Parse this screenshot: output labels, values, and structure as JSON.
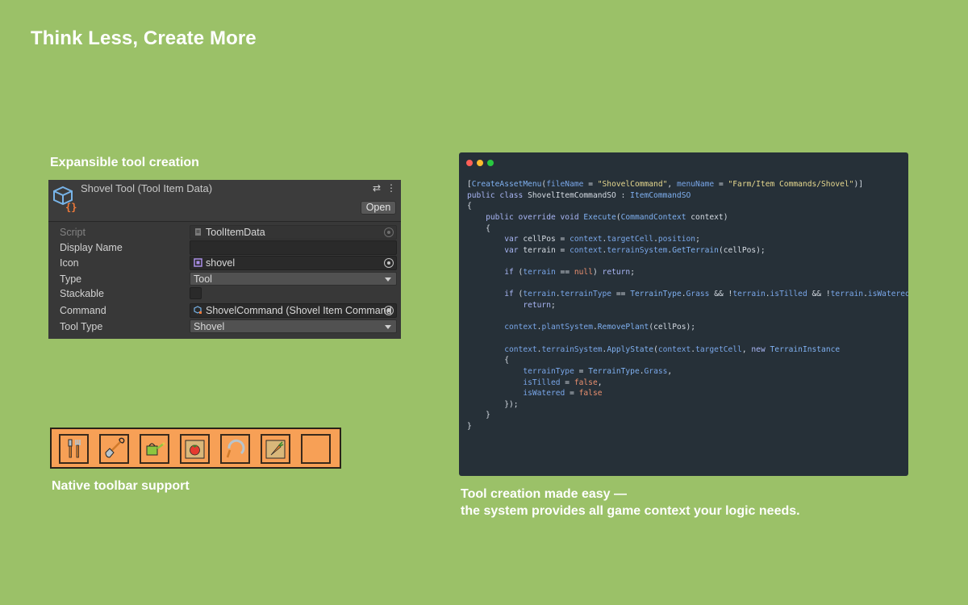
{
  "headline": "Think Less, Create More",
  "sections": {
    "expansible_label": "Expansible tool creation",
    "native_label": "Native toolbar support",
    "caption_line1": "Tool creation made easy —",
    "caption_line2": "the system provides all game context your logic needs."
  },
  "inspector": {
    "title": "Shovel Tool (Tool Item Data)",
    "open_button": "Open",
    "header_icons": [
      "settings-sliders-icon",
      "more-vert-icon"
    ],
    "rows": {
      "script": {
        "label": "Script",
        "value": "ToolItemData"
      },
      "display_name": {
        "label": "Display Name",
        "value": ""
      },
      "icon": {
        "label": "Icon",
        "value": "shovel"
      },
      "type": {
        "label": "Type",
        "value": "Tool"
      },
      "stackable": {
        "label": "Stackable",
        "checked": false
      },
      "command": {
        "label": "Command",
        "value": "ShovelCommand (Shovel Item Command"
      },
      "tool_type": {
        "label": "Tool Type",
        "value": "Shovel"
      }
    }
  },
  "toolbar": {
    "slots": [
      "garden-tools-icon",
      "shovel-icon",
      "watering-can-icon",
      "tomato-seed-bag-icon",
      "sickle-icon",
      "carrot-seed-bag-icon",
      "empty-slot"
    ]
  },
  "code_window": {
    "dot_colors": [
      "#ff5f57",
      "#febc2e",
      "#28c840"
    ],
    "colors": {
      "plain": "#d5dbe3",
      "keyword": "#a9b6f5",
      "type": "#7fb0f0",
      "string": "#e6d88f",
      "member": "#79a6e8",
      "literal": "#e98f6f"
    },
    "lines": [
      [
        [
          "[",
          "plain"
        ],
        [
          "CreateAssetMenu",
          "type"
        ],
        [
          "(",
          "plain"
        ],
        [
          "fileName",
          "member"
        ],
        [
          " = ",
          "plain"
        ],
        [
          "\"ShovelCommand\"",
          "string"
        ],
        [
          ", ",
          "plain"
        ],
        [
          "menuName",
          "member"
        ],
        [
          " = ",
          "plain"
        ],
        [
          "\"Farm/Item Commands/Shovel\"",
          "string"
        ],
        [
          ")]",
          "plain"
        ]
      ],
      [
        [
          "public class ",
          "keyword"
        ],
        [
          "ShovelItemCommandSO",
          "plain"
        ],
        [
          " : ",
          "plain"
        ],
        [
          "ItemCommandSO",
          "type"
        ]
      ],
      [
        [
          "{",
          "plain"
        ]
      ],
      [
        [
          "    ",
          "plain"
        ],
        [
          "public override void ",
          "keyword"
        ],
        [
          "Execute",
          "type"
        ],
        [
          "(",
          "plain"
        ],
        [
          "CommandContext",
          "type"
        ],
        [
          " context)",
          "plain"
        ]
      ],
      [
        [
          "    {",
          "plain"
        ]
      ],
      [
        [
          "        ",
          "plain"
        ],
        [
          "var ",
          "keyword"
        ],
        [
          "cellPos = ",
          "plain"
        ],
        [
          "context",
          "member"
        ],
        [
          ".",
          "plain"
        ],
        [
          "targetCell",
          "member"
        ],
        [
          ".",
          "plain"
        ],
        [
          "position",
          "member"
        ],
        [
          ";",
          "plain"
        ]
      ],
      [
        [
          "        ",
          "plain"
        ],
        [
          "var ",
          "keyword"
        ],
        [
          "terrain = ",
          "plain"
        ],
        [
          "context",
          "member"
        ],
        [
          ".",
          "plain"
        ],
        [
          "terrainSystem",
          "member"
        ],
        [
          ".",
          "plain"
        ],
        [
          "GetTerrain",
          "type"
        ],
        [
          "(cellPos);",
          "plain"
        ]
      ],
      [],
      [
        [
          "        ",
          "plain"
        ],
        [
          "if ",
          "keyword"
        ],
        [
          "(",
          "plain"
        ],
        [
          "terrain",
          "member"
        ],
        [
          " == ",
          "plain"
        ],
        [
          "null",
          "literal"
        ],
        [
          ") ",
          "plain"
        ],
        [
          "return",
          "keyword"
        ],
        [
          ";",
          "plain"
        ]
      ],
      [],
      [
        [
          "        ",
          "plain"
        ],
        [
          "if ",
          "keyword"
        ],
        [
          "(",
          "plain"
        ],
        [
          "terrain",
          "member"
        ],
        [
          ".",
          "plain"
        ],
        [
          "terrainType",
          "member"
        ],
        [
          " == ",
          "plain"
        ],
        [
          "TerrainType",
          "type"
        ],
        [
          ".",
          "plain"
        ],
        [
          "Grass",
          "member"
        ],
        [
          " && !",
          "plain"
        ],
        [
          "terrain",
          "member"
        ],
        [
          ".",
          "plain"
        ],
        [
          "isTilled",
          "member"
        ],
        [
          " && !",
          "plain"
        ],
        [
          "terrain",
          "member"
        ],
        [
          ".",
          "plain"
        ],
        [
          "isWatered",
          "member"
        ],
        [
          ")",
          "plain"
        ]
      ],
      [
        [
          "            ",
          "plain"
        ],
        [
          "return",
          "keyword"
        ],
        [
          ";",
          "plain"
        ]
      ],
      [],
      [
        [
          "        ",
          "plain"
        ],
        [
          "context",
          "member"
        ],
        [
          ".",
          "plain"
        ],
        [
          "plantSystem",
          "member"
        ],
        [
          ".",
          "plain"
        ],
        [
          "RemovePlant",
          "type"
        ],
        [
          "(cellPos);",
          "plain"
        ]
      ],
      [],
      [
        [
          "        ",
          "plain"
        ],
        [
          "context",
          "member"
        ],
        [
          ".",
          "plain"
        ],
        [
          "terrainSystem",
          "member"
        ],
        [
          ".",
          "plain"
        ],
        [
          "ApplyState",
          "type"
        ],
        [
          "(",
          "plain"
        ],
        [
          "context",
          "member"
        ],
        [
          ".",
          "plain"
        ],
        [
          "targetCell",
          "member"
        ],
        [
          ", ",
          "plain"
        ],
        [
          "new ",
          "keyword"
        ],
        [
          "TerrainInstance",
          "type"
        ]
      ],
      [
        [
          "        {",
          "plain"
        ]
      ],
      [
        [
          "            ",
          "plain"
        ],
        [
          "terrainType",
          "member"
        ],
        [
          " = ",
          "plain"
        ],
        [
          "TerrainType",
          "type"
        ],
        [
          ".",
          "plain"
        ],
        [
          "Grass",
          "member"
        ],
        [
          ",",
          "plain"
        ]
      ],
      [
        [
          "            ",
          "plain"
        ],
        [
          "isTilled",
          "member"
        ],
        [
          " = ",
          "plain"
        ],
        [
          "false",
          "literal"
        ],
        [
          ",",
          "plain"
        ]
      ],
      [
        [
          "            ",
          "plain"
        ],
        [
          "isWatered",
          "member"
        ],
        [
          " = ",
          "plain"
        ],
        [
          "false",
          "literal"
        ]
      ],
      [
        [
          "        });",
          "plain"
        ]
      ],
      [
        [
          "    }",
          "plain"
        ]
      ],
      [
        [
          "}",
          "plain"
        ]
      ]
    ]
  }
}
